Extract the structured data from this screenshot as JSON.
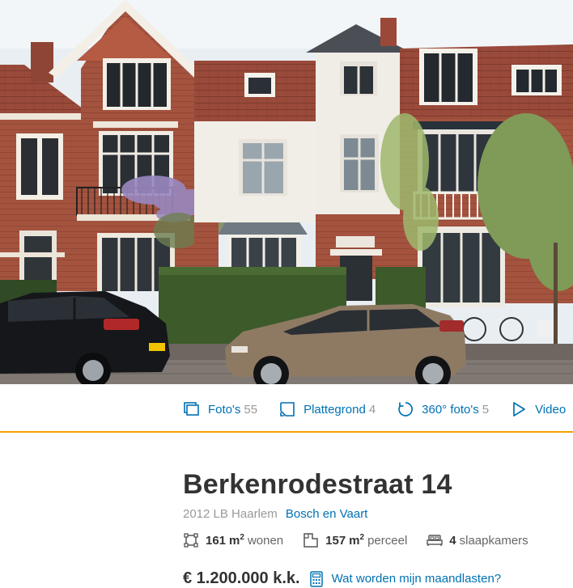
{
  "media": {
    "tabs": [
      {
        "label": "Foto's",
        "count": "55",
        "icon": "photos-icon"
      },
      {
        "label": "Plattegrond",
        "count": "4",
        "icon": "floorplan-icon"
      },
      {
        "label": "360° foto's",
        "count": "5",
        "icon": "rotate-360-icon"
      },
      {
        "label": "Video",
        "count": "",
        "icon": "play-icon"
      }
    ],
    "accent_color": "#f2a100",
    "link_color": "#0071b3"
  },
  "listing": {
    "title": "Berkenrodestraat 14",
    "postal_city": "2012 LB Haarlem",
    "neighborhood": "Bosch en Vaart",
    "features": {
      "living_value": "161",
      "living_unit": "m",
      "living_label": "wonen",
      "plot_value": "157",
      "plot_unit": "m",
      "plot_label": "perceel",
      "bedrooms_value": "4",
      "bedrooms_label": "slaapkamers",
      "sup": "2"
    },
    "price": "€ 1.200.000 k.k.",
    "mortgage_link": "Wat worden mijn maandlasten?"
  }
}
